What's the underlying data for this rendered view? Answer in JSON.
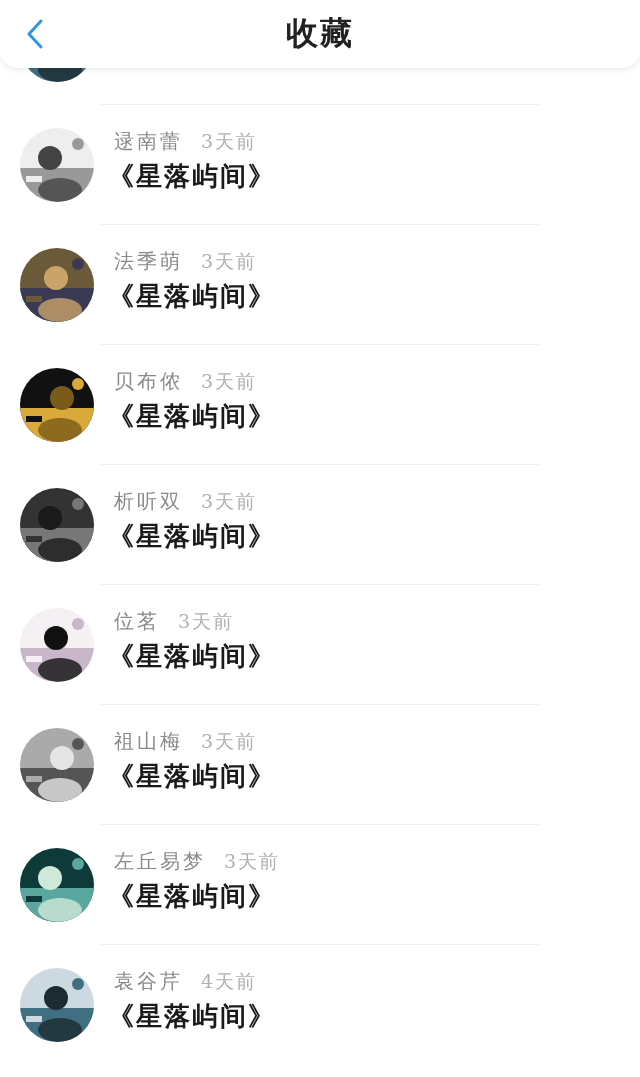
{
  "header": {
    "title": "收藏"
  },
  "items": [
    {
      "name": "逯南蕾",
      "time": "3天前",
      "title": "《星落屿间》"
    },
    {
      "name": "法季萌",
      "time": "3天前",
      "title": "《星落屿间》"
    },
    {
      "name": "贝布侬",
      "time": "3天前",
      "title": "《星落屿间》"
    },
    {
      "name": "析听双",
      "time": "3天前",
      "title": "《星落屿间》"
    },
    {
      "name": "位茗",
      "time": "3天前",
      "title": "《星落屿间》"
    },
    {
      "name": "祖山梅",
      "time": "3天前",
      "title": "《星落屿间》"
    },
    {
      "name": "左丘易梦",
      "time": "3天前",
      "title": "《星落屿间》"
    },
    {
      "name": "袁谷芹",
      "time": "4天前",
      "title": "《星落屿间》"
    }
  ]
}
